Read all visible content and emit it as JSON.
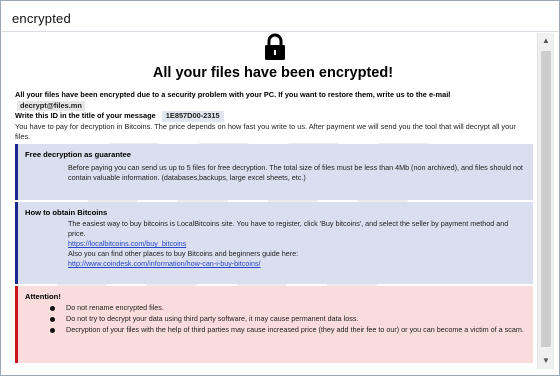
{
  "window": {
    "title": "encrypted"
  },
  "headline": "All your files have been encrypted!",
  "intro": {
    "line1": "All your files have been encrypted due to a security problem with your PC. If you want to restore them, write us to the e-mail",
    "email": "decrypt@files.mn",
    "id_prefix": "Write this ID in the title of your message",
    "id_value": "1E857D00-2315",
    "line3": "You have to pay for decryption in Bitcoins. The price depends on how fast you write to us. After payment we will send you the tool that will decrypt all your files."
  },
  "guarantee": {
    "title": "Free decryption as guarantee",
    "text": "Before paying you can send us up to 5 files for free decryption. The total size of files must be less than 4Mb (non archived), and files should not contain valuable information. (databases,backups, large excel sheets, etc.)"
  },
  "bitcoin": {
    "title": "How to obtain Bitcoins",
    "text1": "The easiest way to buy bitcoins is LocalBitcoins site. You have to register, click 'Buy bitcoins', and select the seller by payment method and price.",
    "link1": "https://localbitcoins.com/buy_bitcoins",
    "text2": "Also you can find other places to buy Bitcoins and beginners guide here:",
    "link2": "http://www.coindesk.com/information/how-can-i-buy-bitcoins/"
  },
  "attention": {
    "title": "Attention!",
    "items": [
      "Do not rename encrypted files.",
      "Do not try to decrypt your data using third party software, it may cause permanent data loss.",
      "Decryption of your files with the help of third parties may cause increased price (they add their fee to our) or you can become a victim of a scam."
    ]
  },
  "colors": {
    "blue_panel": "#d9dfef",
    "blue_accent": "#1a2a8a",
    "red_panel": "#fadcdc",
    "red_accent": "#c8141c",
    "link": "#2846c8"
  },
  "icons": {
    "lock": "lock-icon",
    "scroll_up": "scroll-up-arrow-icon",
    "scroll_down": "scroll-down-arrow-icon"
  }
}
